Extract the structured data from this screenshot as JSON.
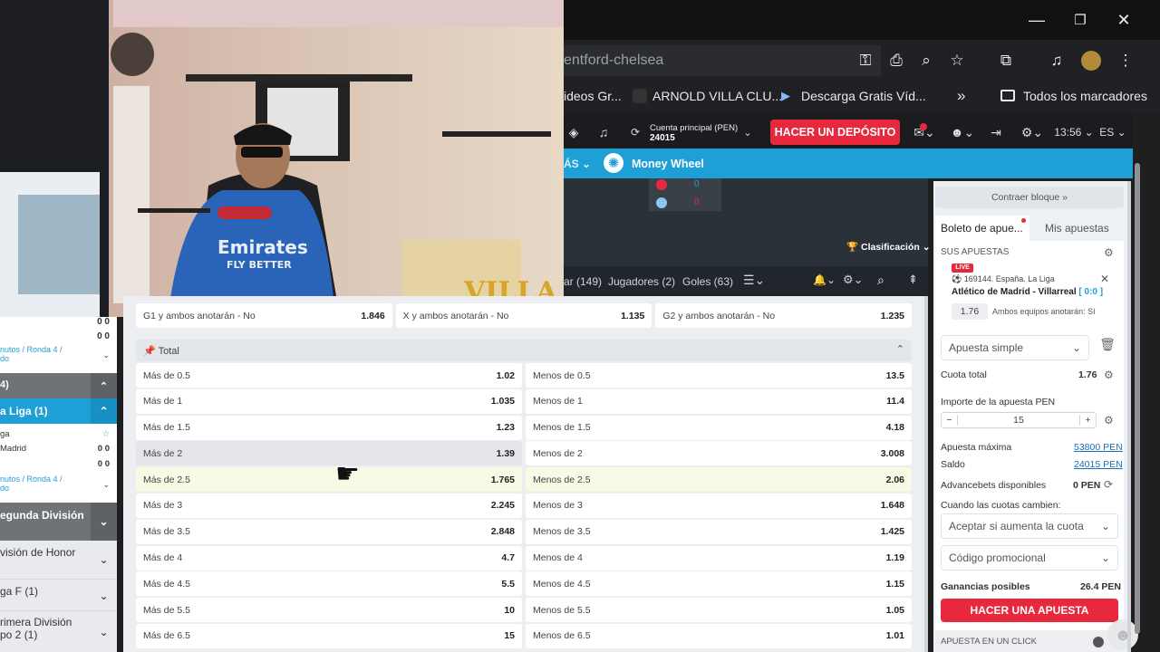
{
  "window": {
    "minimize": "—",
    "restore": "❐",
    "close": "✕"
  },
  "browser": {
    "url": "entford-chelsea",
    "bookmarks": [
      "ideos Gr...",
      "ARNOLD VILLA CLU...",
      "Descarga Gratis Víd..."
    ],
    "bookmarks_more": "»",
    "all_bookmarks": "Todos los marcadores"
  },
  "site": {
    "account_label": "Cuenta principal  (PEN)",
    "account_value": "24015",
    "deposit": "HACER UN DEPÓSITO",
    "time": "13:56",
    "lang": "ES",
    "nav_more": "ÁS",
    "money_wheel": "Money Wheel",
    "score": [
      "0",
      "0"
    ],
    "clasificacion": "Clasificación",
    "tabs": [
      "ar (149)",
      "Jugadores (2)",
      "Goles (63)"
    ]
  },
  "market": {
    "top_row": [
      {
        "label": "G1 y ambos anotarán - No",
        "odd": "1.846"
      },
      {
        "label": "X y ambos anotarán - No",
        "odd": "1.135"
      },
      {
        "label": "G2 y ambos anotarán - No",
        "odd": "1.235"
      }
    ],
    "total_title": "Total",
    "rows": [
      {
        "over": "Más de 0.5",
        "over_odd": "1.02",
        "under": "Menos de 0.5",
        "under_odd": "13.5"
      },
      {
        "over": "Más de 1",
        "over_odd": "1.035",
        "under": "Menos de 1",
        "under_odd": "11.4"
      },
      {
        "over": "Más de 1.5",
        "over_odd": "1.23",
        "under": "Menos de 1.5",
        "under_odd": "4.18"
      },
      {
        "over": "Más de 2",
        "over_odd": "1.39",
        "under": "Menos de 2",
        "under_odd": "3.008"
      },
      {
        "over": "Más de 2.5",
        "over_odd": "1.765",
        "under": "Menos de 2.5",
        "under_odd": "2.06"
      },
      {
        "over": "Más de 3",
        "over_odd": "2.245",
        "under": "Menos de 3",
        "under_odd": "1.648"
      },
      {
        "over": "Más de 3.5",
        "over_odd": "2.848",
        "under": "Menos de 3.5",
        "under_odd": "1.425"
      },
      {
        "over": "Más de 4",
        "over_odd": "4.7",
        "under": "Menos de 4",
        "under_odd": "1.19"
      },
      {
        "over": "Más de 4.5",
        "over_odd": "5.5",
        "under": "Menos de 4.5",
        "under_odd": "1.15"
      },
      {
        "over": "Más de 5.5",
        "over_odd": "10",
        "under": "Menos de 5.5",
        "under_odd": "1.05"
      },
      {
        "over": "Más de 6.5",
        "over_odd": "15",
        "under": "Menos de 6.5",
        "under_odd": "1.01"
      }
    ]
  },
  "left": {
    "scores1": [
      "0 0",
      "0 0"
    ],
    "round1": "nutos / Ronda 4 /",
    "round1b": "do",
    "sec_count": "4)",
    "laliga": "a Liga (1)",
    "team1": "ga",
    "team2": "Madrid",
    "scores2": [
      "0 0",
      "0 0"
    ],
    "round2": "nutos / Ronda 4 /",
    "round2b": "do",
    "segunda": "egunda División",
    "honor": "visión de Honor",
    "ligaf": "ga F (1)",
    "primera": "rimera División",
    "primera2": "po 2 (1)"
  },
  "slip": {
    "contraer": "Contraer bloque",
    "tab_boleto": "Boleto de apue...",
    "tab_mis": "Mis apuestas",
    "sus_apuestas": "SUS APUESTAS",
    "live": "LIVE",
    "event_id": "169144. España. La Liga",
    "match": "Atlético de Madrid - Villarreal",
    "match_score": "[ 0:0 ]",
    "odd": "1.76",
    "market": "Ambos equipos anotarán: Sí",
    "bet_type": "Apuesta simple",
    "cuota_total_label": "Cuota total",
    "cuota_total": "1.76",
    "importe_label": "Importe de la apuesta PEN",
    "importe": "15",
    "max_label": "Apuesta máxima",
    "max_value": "53800 PEN",
    "saldo_label": "Saldo",
    "saldo_value": "24015 PEN",
    "advance_label": "Advancebets disponibles",
    "advance_value": "0 PEN",
    "odds_change_label": "Cuando las cuotas cambien:",
    "odds_change_value": "Aceptar si aumenta la cuota",
    "promo": "Código promocional",
    "ganancias_label": "Ganancias posibles",
    "ganancias_value": "26.4 PEN",
    "place_bet": "HACER UNA APUESTA",
    "one_click": "APUESTA EN UN CLICK"
  },
  "overlay": {
    "logo_text": "VILLA"
  },
  "colors": {
    "accent_red": "#e8283c",
    "accent_blue": "#1ea0d6",
    "link_blue": "#1a6fb5"
  }
}
